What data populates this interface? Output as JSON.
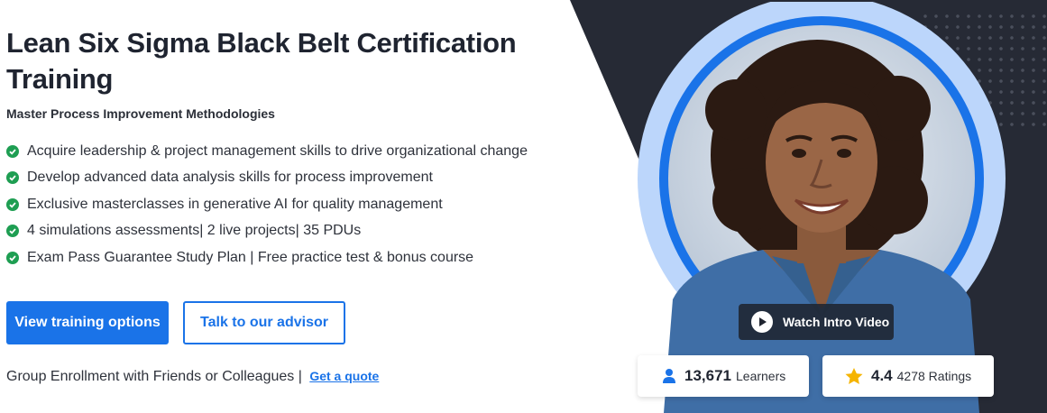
{
  "hero": {
    "title": "Lean Six Sigma Black Belt Certification Training",
    "subtitle": "Master Process Improvement Methodologies",
    "features": [
      "Acquire leadership & project management skills to drive organizational change",
      "Develop advanced data analysis skills for process improvement",
      "Exclusive masterclasses in generative AI for quality management",
      "4 simulations assessments| 2 live projects| 35 PDUs",
      "Exam Pass Guarantee Study Plan | Free practice test & bonus course"
    ],
    "primary_button": "View training options",
    "secondary_button": "Talk to our advisor",
    "group_text": "Group Enrollment with Friends or Colleagues |",
    "group_link": "Get a quote"
  },
  "media": {
    "watch_label": "Watch Intro Video",
    "learners_count": "13,671",
    "learners_label": "Learners",
    "rating_value": "4.4",
    "ratings_label": "4278 Ratings"
  },
  "colors": {
    "accent": "#1a73e8",
    "check": "#1e9e52",
    "dark_panel": "#262a35",
    "ring": "#1a73e8",
    "star": "#f5b400"
  },
  "icons": {
    "check": "check-circle-icon",
    "play": "play-icon",
    "learner": "user-icon",
    "star": "star-icon"
  }
}
